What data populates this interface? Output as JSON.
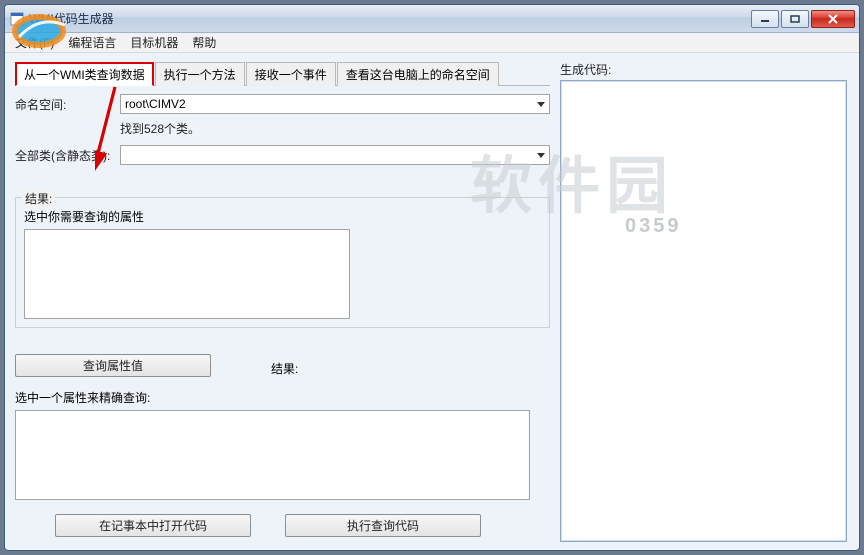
{
  "window": {
    "title": "WMI代码生成器"
  },
  "menu": {
    "file": "文件(F)",
    "lang": "编程语言",
    "target": "目标机器",
    "help": "帮助"
  },
  "tabs": {
    "t1": "从一个WMI类查询数据",
    "t2": "执行一个方法",
    "t3": "接收一个事件",
    "t4": "查看这台电脑上的命名空间"
  },
  "labels": {
    "namespace": "命名空间:",
    "allclasses": "全部类(含静态类):",
    "found": "找到528个类。",
    "result": "结果:",
    "selectProp": "选中你需要查询的属性",
    "queryBtn": "查询属性值",
    "result2": "结果:",
    "selectOne": "选中一个属性来精确查询:",
    "openNotepad": "在记事本中打开代码",
    "execCode": "执行查询代码",
    "genCode": "生成代码:"
  },
  "values": {
    "namespace": "root\\CIMV2",
    "classSel": ""
  },
  "watermark": {
    "text": "软件园",
    "url": "0359"
  }
}
